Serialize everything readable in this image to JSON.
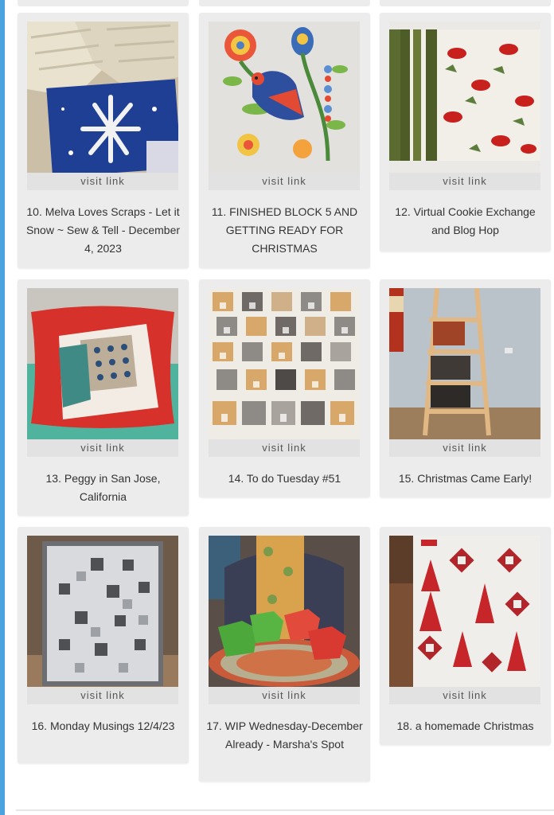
{
  "visit_label": "visit link",
  "items": [
    {
      "title": "10. Melva Loves Scraps - Let it Snow ~ Sew & Tell - December 4, 2023",
      "image": "mittens and snowflake quilt block"
    },
    {
      "title": "11. FINISHED BLOCK 5 AND GETTING READY FOR CHRISTMAS",
      "image": "applique bird on flowering branch"
    },
    {
      "title": "12. Virtual Cookie Exchange and Blog Hop",
      "image": "cardinal print fabric napkins"
    },
    {
      "title": "13. Peggy in San Jose, California",
      "image": "red cross-stitch pillow"
    },
    {
      "title": "14. To do Tuesday #51",
      "image": "cat faces quilt"
    },
    {
      "title": "15. Christmas Came Early!",
      "image": "wooden quilt ladder rack"
    },
    {
      "title": "16. Monday Musings 12/4/23",
      "image": "grey star quilt outdoors"
    },
    {
      "title": "17. WIP Wednesday-December Already - Marsha's Spot",
      "image": "fabric baskets and round rug"
    },
    {
      "title": "18. a homemade Christmas",
      "image": "red Christmas tree quilt"
    }
  ],
  "colors": {
    "accent_rail": "#4aa3df",
    "card_bg": "#ececec"
  }
}
